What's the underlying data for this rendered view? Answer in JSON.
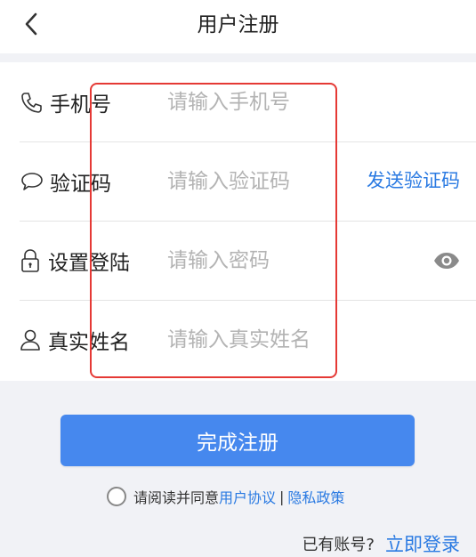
{
  "header": {
    "title": "用户注册",
    "back_icon": "chevron-left-icon"
  },
  "form": {
    "fields": [
      {
        "icon": "phone-icon",
        "label": "手机号",
        "placeholder": "请输入手机号",
        "value": ""
      },
      {
        "icon": "chat-bubble-icon",
        "label": "验证码",
        "placeholder": "请输入验证码",
        "value": "",
        "action": "发送验证码"
      },
      {
        "icon": "lock-icon",
        "label": "设置登陆",
        "placeholder": "请输入密码",
        "value": "",
        "toggle_icon": "eye-icon"
      },
      {
        "icon": "user-icon",
        "label": "真实姓名",
        "placeholder": "请输入真实姓名",
        "value": ""
      }
    ]
  },
  "submit": {
    "label": "完成注册"
  },
  "agreement": {
    "prefix": "请阅读并同意",
    "user_agreement": "用户协议",
    "separator": "|",
    "privacy_policy": "隐私政策",
    "checked": false
  },
  "login": {
    "question": "已有账号?",
    "link": "立即登录"
  },
  "colors": {
    "accent": "#2a7ae2",
    "button": "#4688ee",
    "highlight": "#e53935",
    "background": "#f1f2f6"
  }
}
